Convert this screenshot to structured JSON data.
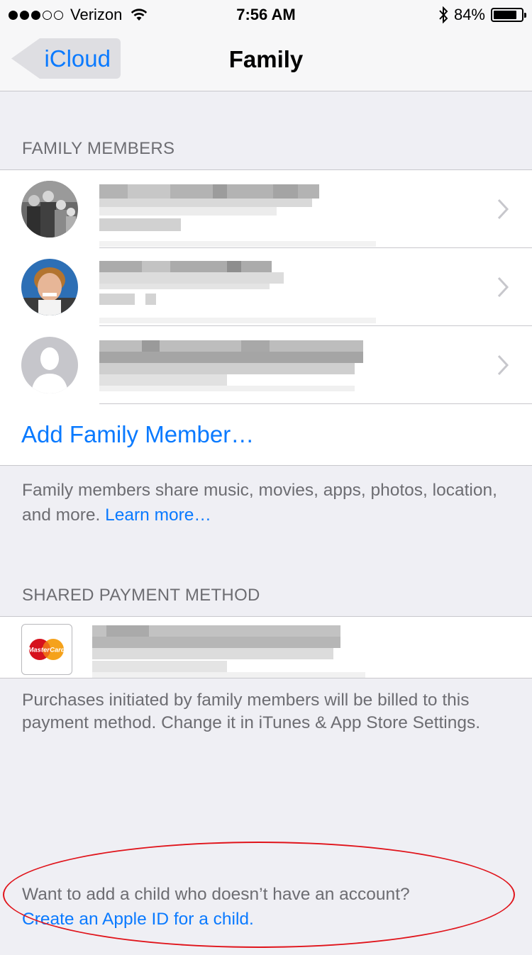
{
  "status_bar": {
    "carrier": "Verizon",
    "signal_bars_filled": 3,
    "signal_bars_total": 5,
    "time": "7:56 AM",
    "battery_percent": "84%",
    "battery_level": 0.84
  },
  "nav": {
    "back_label": "iCloud",
    "title": "Family"
  },
  "family_members": {
    "header": "FAMILY MEMBERS",
    "members": [
      {
        "avatar": "family-photo"
      },
      {
        "avatar": "boy-photo"
      },
      {
        "avatar": "placeholder-silhouette"
      }
    ],
    "add_label": "Add Family Member…",
    "footer_text": "Family members share music, movies, apps, photos, location, and more.",
    "footer_link": "Learn more…"
  },
  "payment": {
    "header": "SHARED PAYMENT METHOD",
    "card_icon": "mastercard-icon",
    "card_brand": "MasterCard",
    "footer_text": "Purchases initiated by family members will be billed to this payment method. Change it in iTunes & App Store Settings."
  },
  "child": {
    "prompt": "Want to add a child who doesn’t have an account?",
    "link": "Create an Apple ID for a child."
  },
  "colors": {
    "accent": "#0a7aff",
    "annotation": "#e0141b"
  }
}
